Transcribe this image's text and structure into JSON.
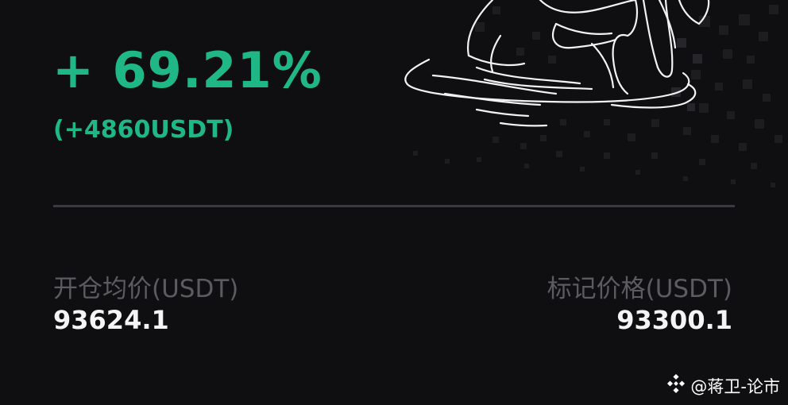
{
  "pnl": {
    "percent": "+ 69.21%",
    "amount": "(+4860USDT)"
  },
  "stats": {
    "entry_label": "开仓均价(USDT)",
    "entry_value": "93624.1",
    "mark_label": "标记价格(USDT)",
    "mark_value": "93300.1"
  },
  "watermark": {
    "icon": "binance-logo-icon",
    "text": "@蒋卫-论市"
  },
  "colors": {
    "background": "#0f0f11",
    "profit_green": "#20b787",
    "label_gray": "#5b5b60",
    "divider": "#3b3b3f"
  }
}
